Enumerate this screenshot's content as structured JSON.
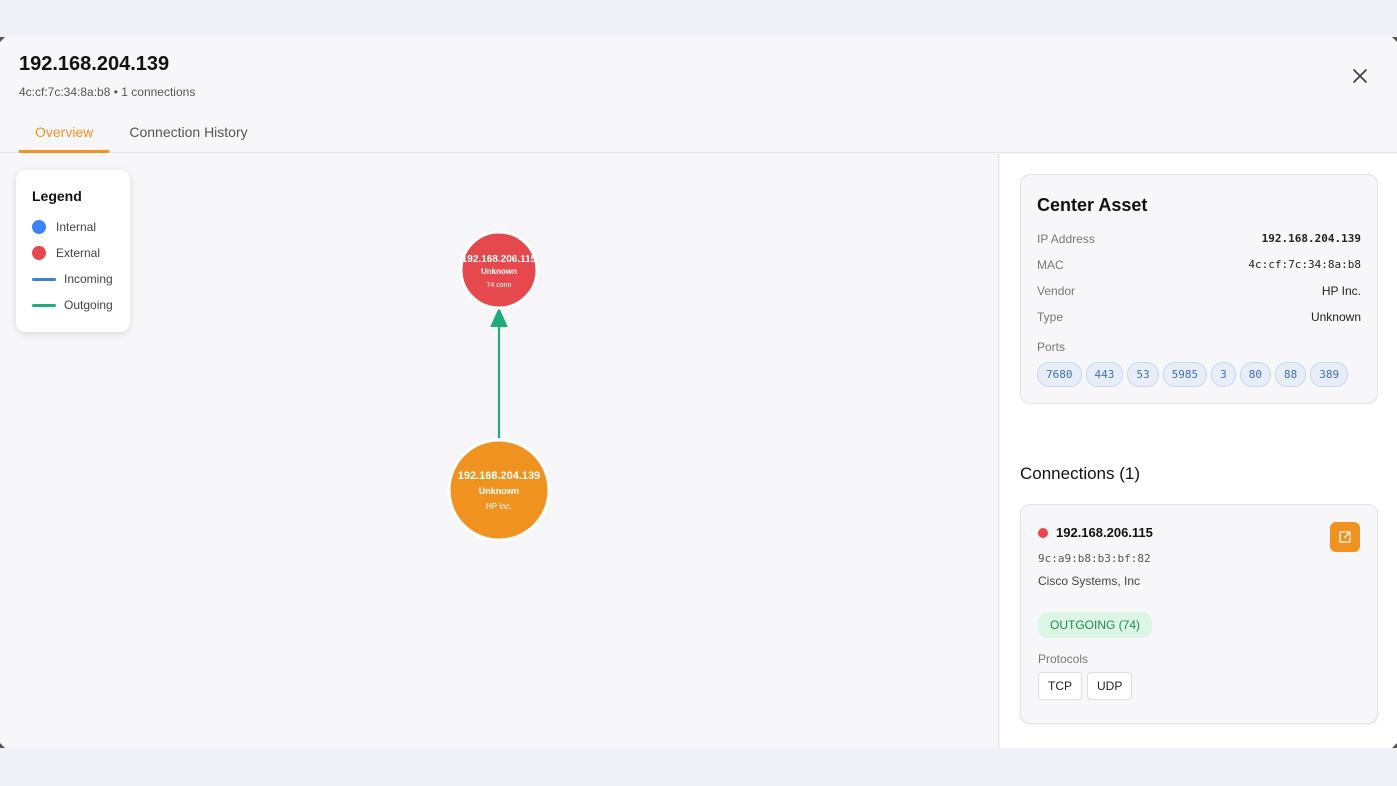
{
  "header": {
    "title": "192.168.204.139",
    "subtitle": "4c:cf:7c:34:8a:b8 • 1 connections",
    "tabs": [
      "Overview",
      "Connection History"
    ],
    "active_tab": "Overview"
  },
  "legend": {
    "title": "Legend",
    "items": [
      {
        "label": "Internal",
        "kind": "dot",
        "color": "#3b82f6"
      },
      {
        "label": "External",
        "kind": "dot",
        "color": "#e5484d"
      },
      {
        "label": "Incoming",
        "kind": "line",
        "color": "#3f7fd1"
      },
      {
        "label": "Outgoing",
        "kind": "line",
        "color": "#1fab7a"
      }
    ]
  },
  "graph": {
    "center_node": {
      "ip": "192.168.204.139",
      "type": "Unknown",
      "vendor": "HP Inc.",
      "color": "#f0921f"
    },
    "remote_node": {
      "ip": "192.168.206.115",
      "type": "Unknown",
      "conn": "74 conn",
      "color": "#e5484d"
    },
    "edge_color": "#1fab7a"
  },
  "center_asset": {
    "title": "Center Asset",
    "rows": [
      {
        "key": "IP Address",
        "value": "192.168.204.139",
        "mono": true
      },
      {
        "key": "MAC",
        "value": "4c:cf:7c:34:8a:b8",
        "mono": true
      },
      {
        "key": "Vendor",
        "value": "HP Inc.",
        "mono": false
      },
      {
        "key": "Type",
        "value": "Unknown",
        "mono": false
      }
    ],
    "ports_label": "Ports",
    "ports": [
      "7680",
      "443",
      "53",
      "5985",
      "3",
      "80",
      "88",
      "389"
    ]
  },
  "connections": {
    "title": "Connections (1)",
    "items": [
      {
        "ip": "192.168.206.115",
        "mac": "9c:a9:b8:b3:bf:82",
        "vendor": "Cisco Systems, Inc",
        "direction": "OUTGOING (74)",
        "protocols_label": "Protocols",
        "protocols": [
          "TCP",
          "UDP"
        ]
      }
    ]
  },
  "icons": {
    "close": "close-icon",
    "open": "external-link-icon"
  }
}
